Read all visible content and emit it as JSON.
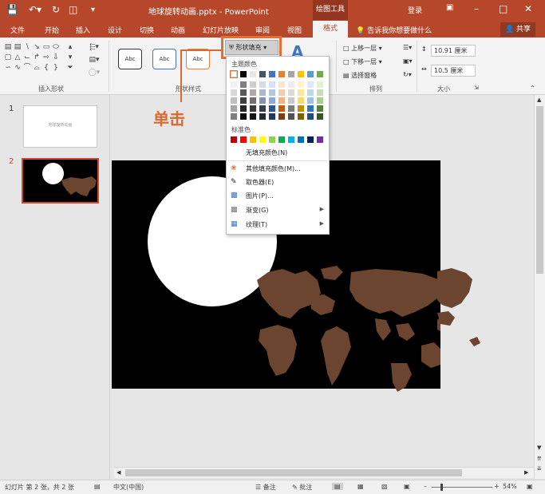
{
  "window": {
    "title": "地球旋转动画.pptx - PowerPoint",
    "context_tool": "绘图工具",
    "login": "登录"
  },
  "tabs": [
    "文件",
    "开始",
    "插入",
    "设计",
    "切换",
    "动画",
    "幻灯片放映",
    "审阅",
    "视图"
  ],
  "active_tab": "格式",
  "tell_me": "告诉我你想要做什么",
  "share": "共享",
  "ribbon": {
    "groups": {
      "insert_shapes": "插入形状",
      "shape_styles": "形状样式",
      "arrange": "排列",
      "size": "大小"
    },
    "style_preview": "Abc",
    "fill_button": "形状填充",
    "arrange": {
      "bring_forward": "上移一层",
      "send_backward": "下移一层",
      "selection_pane": "选择窗格"
    },
    "size": {
      "height": "10.91 厘米",
      "width": "10.5 厘米"
    }
  },
  "fill_menu": {
    "theme_colors_label": "主题颜色",
    "standard_colors_label": "标准色",
    "theme_top_row": [
      "#ffffff",
      "#000000",
      "#e7e6e6",
      "#44546a",
      "#4472c4",
      "#ed7d31",
      "#a5a5a5",
      "#ffc000",
      "#5b9bd5",
      "#70ad47"
    ],
    "theme_shades": [
      [
        "#f2f2f2",
        "#7f7f7f",
        "#d0cece",
        "#d6dce4",
        "#d9e2f3",
        "#fbe5d5",
        "#ededed",
        "#fff2cc",
        "#deebf6",
        "#e2efd9"
      ],
      [
        "#d8d8d8",
        "#595959",
        "#aeaaaa",
        "#adb9ca",
        "#b4c6e7",
        "#f7cbac",
        "#dbdbdb",
        "#fee599",
        "#bdd7ee",
        "#c5e0b3"
      ],
      [
        "#bfbfbf",
        "#3f3f3f",
        "#757070",
        "#8496b0",
        "#8eaadb",
        "#f4b183",
        "#c9c9c9",
        "#ffd965",
        "#9cc3e5",
        "#a8d08d"
      ],
      [
        "#a5a5a5",
        "#262626",
        "#3a3838",
        "#323f4f",
        "#2f5496",
        "#c55a11",
        "#7b7b7b",
        "#bf9000",
        "#2e75b5",
        "#538135"
      ],
      [
        "#7f7f7f",
        "#0c0c0c",
        "#171616",
        "#222a35",
        "#1f3864",
        "#833c0b",
        "#525252",
        "#7f6000",
        "#1e4e79",
        "#375623"
      ]
    ],
    "standard": [
      "#c00000",
      "#ff0000",
      "#ffc000",
      "#ffff00",
      "#92d050",
      "#00b050",
      "#00b0f0",
      "#0070c0",
      "#002060",
      "#7030a0"
    ],
    "no_fill": "无填充颜色(N)",
    "items": [
      {
        "label": "其他填充颜色(M)...",
        "icon": "palette-icon",
        "has_sub": false
      },
      {
        "label": "取色器(E)",
        "icon": "eyedropper-icon",
        "has_sub": false
      },
      {
        "label": "图片(P)...",
        "icon": "picture-icon",
        "has_sub": false
      },
      {
        "label": "渐变(G)",
        "icon": "gradient-icon",
        "has_sub": true
      },
      {
        "label": "纹理(T)",
        "icon": "texture-icon",
        "has_sub": true
      }
    ]
  },
  "annotation": "单击",
  "slides": [
    {
      "number": "1",
      "thumb_text": "地球旋转动画"
    },
    {
      "number": "2"
    }
  ],
  "slide_colors": {
    "background": "#000000",
    "circle": "#ffffff",
    "land": "#6b4530",
    "accent": "#b7472a",
    "highlight": "#e06f38"
  },
  "status": {
    "slide_info": "幻灯片 第 2 张，共 2 张",
    "language": "中文(中国)",
    "notes": "备注",
    "comments": "批注",
    "zoom": "54%"
  }
}
